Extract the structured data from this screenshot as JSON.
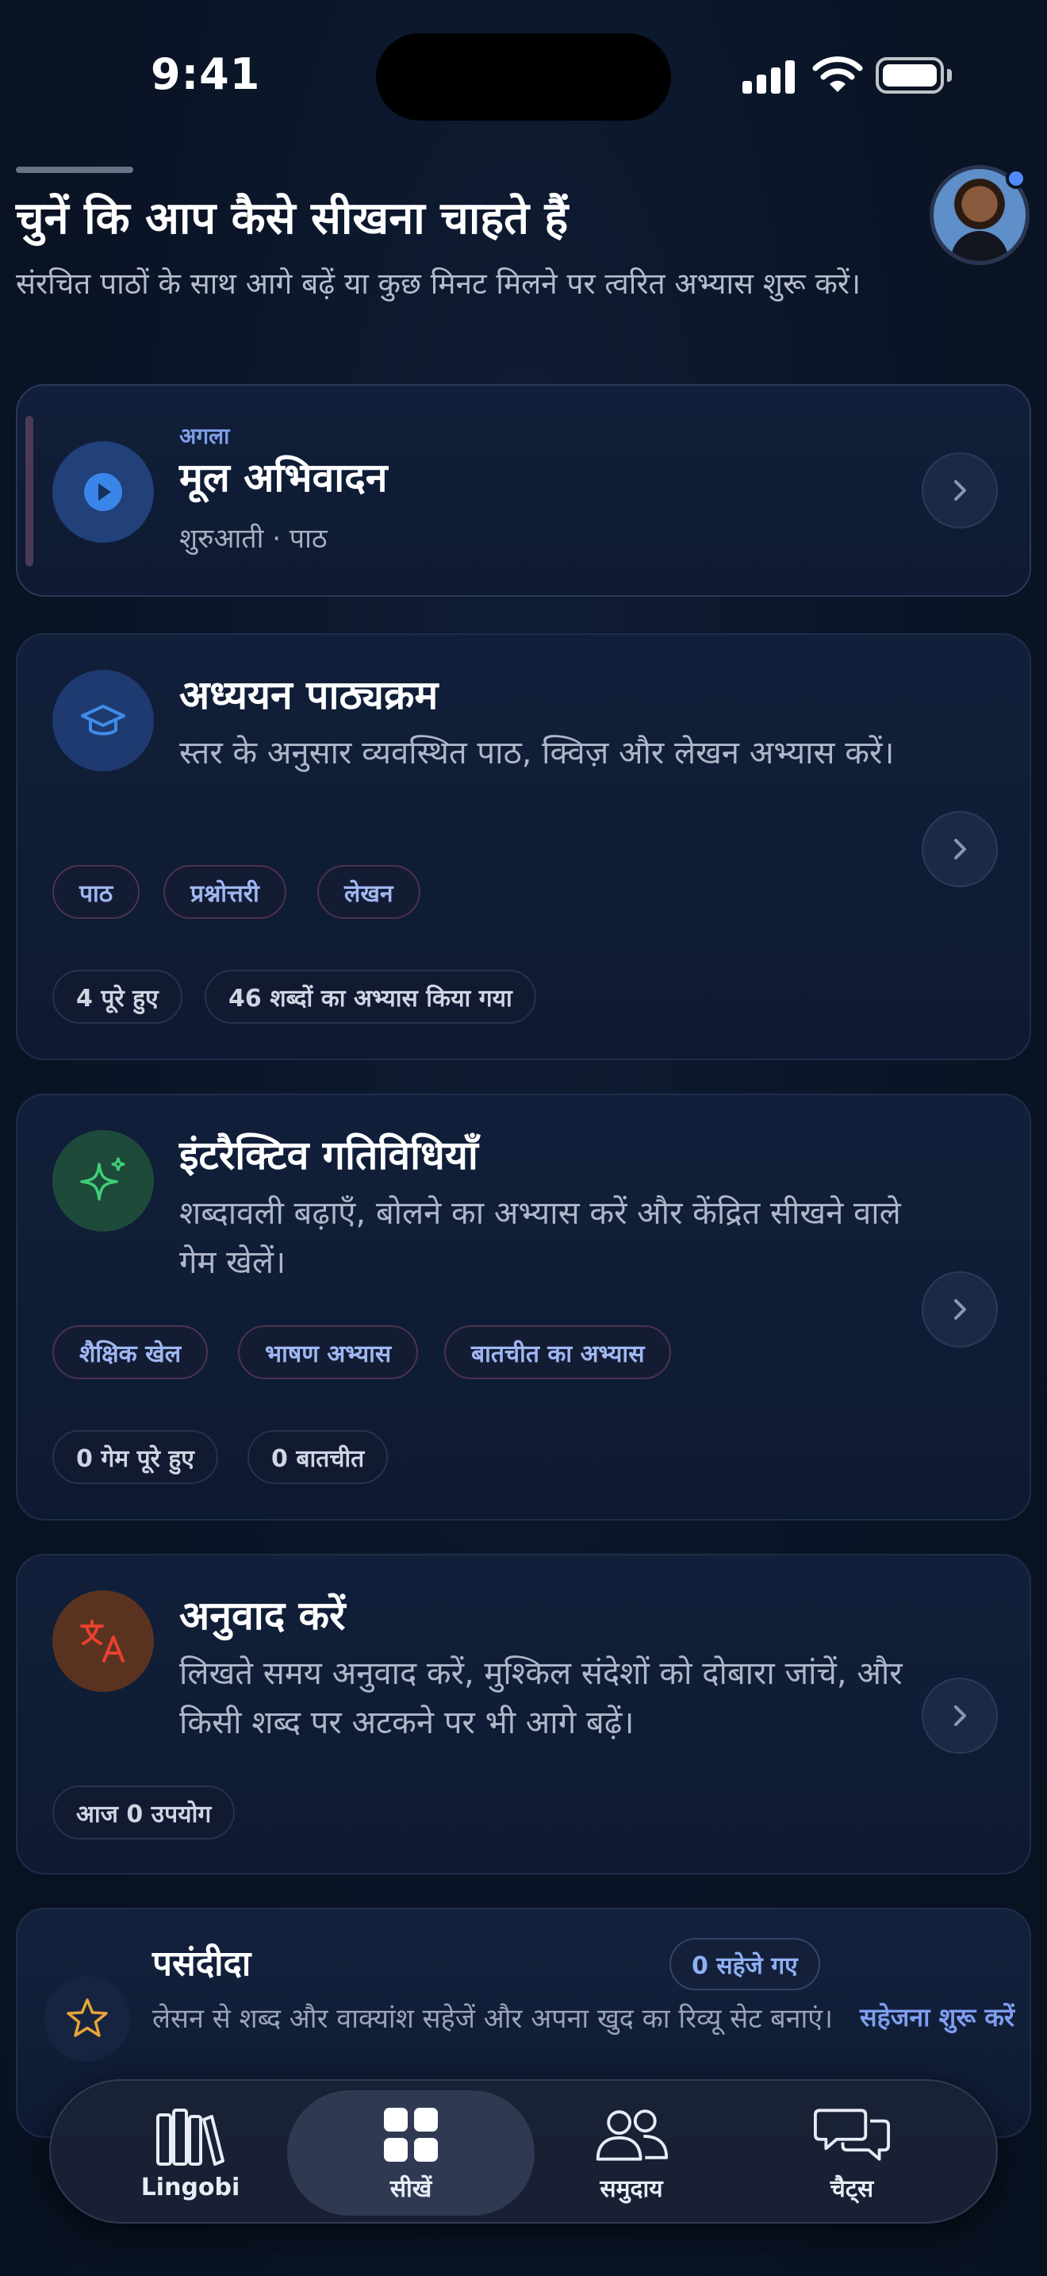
{
  "status_bar": {
    "time": "9:41"
  },
  "header": {
    "title": "चुनें कि आप कैसे सीखना चाहते हैं",
    "subtitle": "संरचित पाठों के साथ आगे बढ़ें या कुछ मिनट मिलने पर त्वरित अभ्यास शुरू करें।"
  },
  "next_lesson": {
    "label": "अगला",
    "title": "मूल अभिवादन",
    "meta": "शुरुआती · पाठ",
    "icon": "play-icon"
  },
  "study": {
    "title": "अध्ययन पाठ्यक्रम",
    "description": "स्तर के अनुसार व्यवस्थित पाठ, क्विज़ और लेखन अभ्यास करें।",
    "tags": [
      "पाठ",
      "प्रश्नोत्तरी",
      "लेखन"
    ],
    "stats": [
      "4 पूरे हुए",
      "46 शब्दों का अभ्यास किया गया"
    ],
    "icon": "graduation-cap-icon"
  },
  "activities": {
    "title": "इंटरैक्टिव गतिविधियाँ",
    "description": "शब्दावली बढ़ाएँ, बोलने का अभ्यास करें और केंद्रित सीखने वाले गेम खेलें।",
    "tags": [
      "शैक्षिक खेल",
      "भाषण अभ्यास",
      "बातचीत का अभ्यास"
    ],
    "stats": [
      "0 गेम पूरे हुए",
      "0 बातचीत"
    ],
    "icon": "sparkles-icon"
  },
  "translate": {
    "title": "अनुवाद करें",
    "description": "लिखते समय अनुवाद करें, मुश्किल संदेशों को दोबारा जांचें, और किसी शब्द पर अटकने पर भी आगे बढ़ें।",
    "stats": [
      "आज 0 उपयोग"
    ],
    "icon": "translate-icon"
  },
  "favorites": {
    "title": "पसंदीदा",
    "badge": "0 सहेजे गए",
    "description": "लेसन से शब्द और वाक्यांश सहेजें और अपना खुद का रिव्यू सेट बनाएं।",
    "link": "सहेजना शुरू करें",
    "icon": "star-icon"
  },
  "tabs": [
    {
      "label": "Lingobi",
      "icon": "library-icon",
      "active": false
    },
    {
      "label": "सीखें",
      "icon": "grid-icon",
      "active": true
    },
    {
      "label": "समुदाय",
      "icon": "people-icon",
      "active": false
    },
    {
      "label": "चैट्स",
      "icon": "chat-bubbles-icon",
      "active": false
    }
  ],
  "colors": {
    "background": "#0a1426",
    "accent_blue": "#7f9ef0",
    "pill_border": "#4b3350",
    "card": "#111f3a"
  }
}
